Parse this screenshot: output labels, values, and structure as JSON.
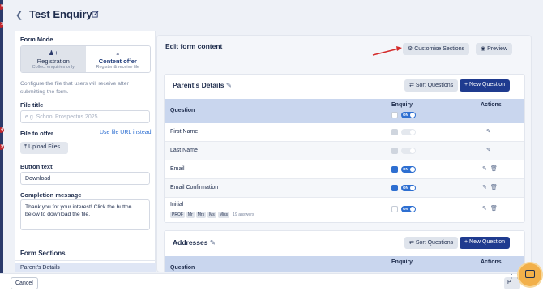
{
  "header": {
    "title": "Test Enquiry"
  },
  "left": {
    "form_mode_label": "Form Mode",
    "modes": [
      {
        "title": "Registration",
        "subtitle": "Collect enquiries only",
        "icon": "add-user-icon"
      },
      {
        "title": "Content offer",
        "subtitle": "Register & receive file",
        "icon": "download-icon"
      }
    ],
    "description": "Configure the file that users will receive after submitting the form.",
    "file_title_label": "File title",
    "file_title_placeholder": "e.g. School Prospectus 2025",
    "file_to_offer_label": "File to offer",
    "file_url_link": "Use file URL instead",
    "upload_label": "Upload Files",
    "button_text_label": "Button text",
    "button_text_value": "Download",
    "completion_label": "Completion message",
    "completion_value": "Thank you for your interest! Click the button below to download the file.",
    "form_sections_label": "Form Sections",
    "section_item": "Parent's Details"
  },
  "right": {
    "edit_title": "Edit form content",
    "customise_label": "Customise Sections",
    "preview_label": "Preview",
    "sort_label": "Sort Questions",
    "new_question_label": "New Question",
    "col_question": "Question",
    "col_enquiry": "Enquiry",
    "col_actions": "Actions",
    "toggle_on": "ON",
    "sections": [
      {
        "title": "Parent's Details",
        "rows": [
          {
            "label": "First Name",
            "state": "disabled"
          },
          {
            "label": "Last Name",
            "state": "disabled"
          },
          {
            "label": "Email",
            "state": "on"
          },
          {
            "label": "Email Confirmation",
            "state": "on"
          },
          {
            "label": "Initial",
            "state": "partial",
            "chips": [
              "PROF",
              "Mr",
              "Mrs",
              "Ms",
              "Miss"
            ],
            "chip_note": "19 answers"
          }
        ]
      },
      {
        "title": "Addresses",
        "rows": []
      }
    ]
  },
  "footer": {
    "cancel_label": "Cancel",
    "p_label": "P"
  },
  "colors": {
    "primary": "#1f3b8f",
    "accent": "#2e6fd1",
    "arrow": "#d42b2b"
  }
}
